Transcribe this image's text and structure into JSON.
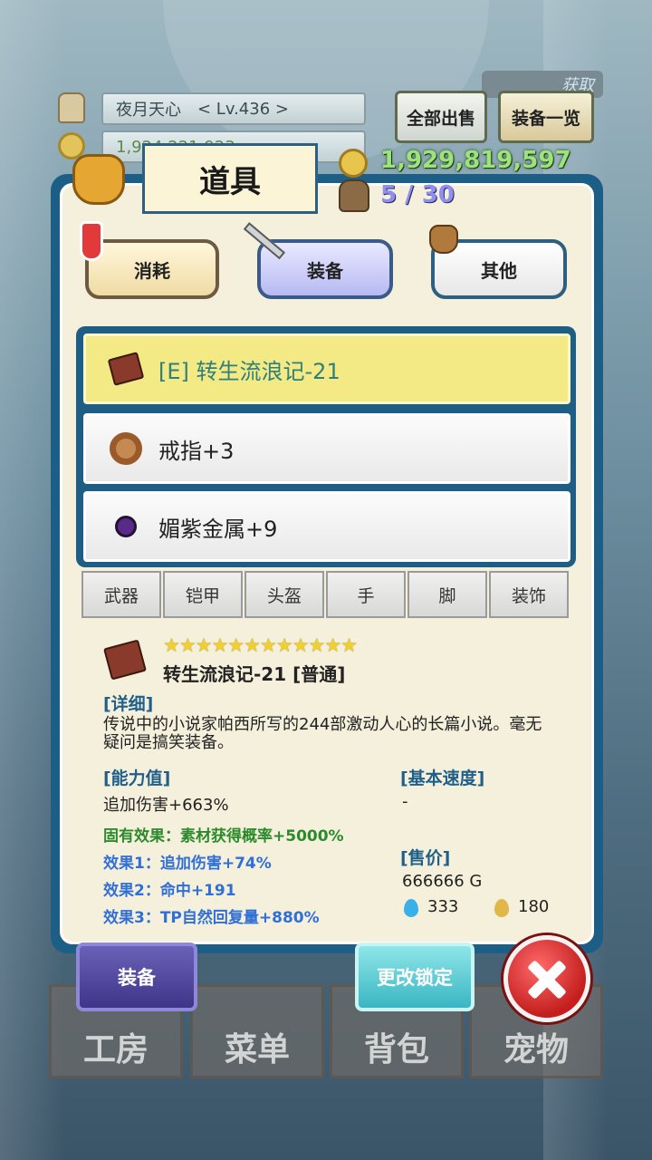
{
  "player": {
    "name": "夜月天心",
    "level": "< Lv.436 >",
    "gold_partial": "1,924,221,923"
  },
  "header_buttons": {
    "sell_all": "全部出售",
    "equip_list": "装备一览",
    "acquire": "获取"
  },
  "inventory": {
    "title": "道具",
    "gold": "1,929,819,597",
    "capacity": "5 / 30"
  },
  "categories": [
    {
      "label": "消耗"
    },
    {
      "label": "装备"
    },
    {
      "label": "其他"
    }
  ],
  "items": [
    {
      "name": "[E] 转生流浪记-21",
      "icon": "book-icon"
    },
    {
      "name": "戒指+3",
      "icon": "ring-icon"
    },
    {
      "name": "媚紫金属+9",
      "icon": "gem-icon"
    }
  ],
  "slot_tabs": [
    "武器",
    "铠甲",
    "头盔",
    "手",
    "脚",
    "装饰"
  ],
  "detail": {
    "stars": "★★★★★★★★★★★★",
    "item_title": "转生流浪记-21 [普通]",
    "detail_header": "[详细]",
    "description": "传说中的小说家帕西所写的244部激动人心的长篇小说。毫无疑问是搞笑装备。",
    "ability_header": "[能力值]",
    "ability_value": "追加伤害+663%",
    "inherent_effect": "固有效果：素材获得概率+5000%",
    "effect1": "效果1：追加伤害+74%",
    "effect2": "效果2：命中+191",
    "effect3": "效果3：TP自然回复量+880%",
    "speed_header": "[基本速度]",
    "speed_value": "-",
    "price_header": "[售价]",
    "price_value": "666666 G",
    "water_value": "333",
    "drop_value": "180"
  },
  "actions": {
    "equip": "装备",
    "change_lock": "更改锁定"
  },
  "nav": [
    "工房",
    "菜单",
    "背包",
    "宠物"
  ],
  "colors": {
    "panel_blue": "#1d5e86",
    "selected_row": "#f3ea86",
    "effect_green": "#2b8a2b",
    "effect_blue": "#2f6fd6",
    "close_red": "#d42a2a"
  }
}
